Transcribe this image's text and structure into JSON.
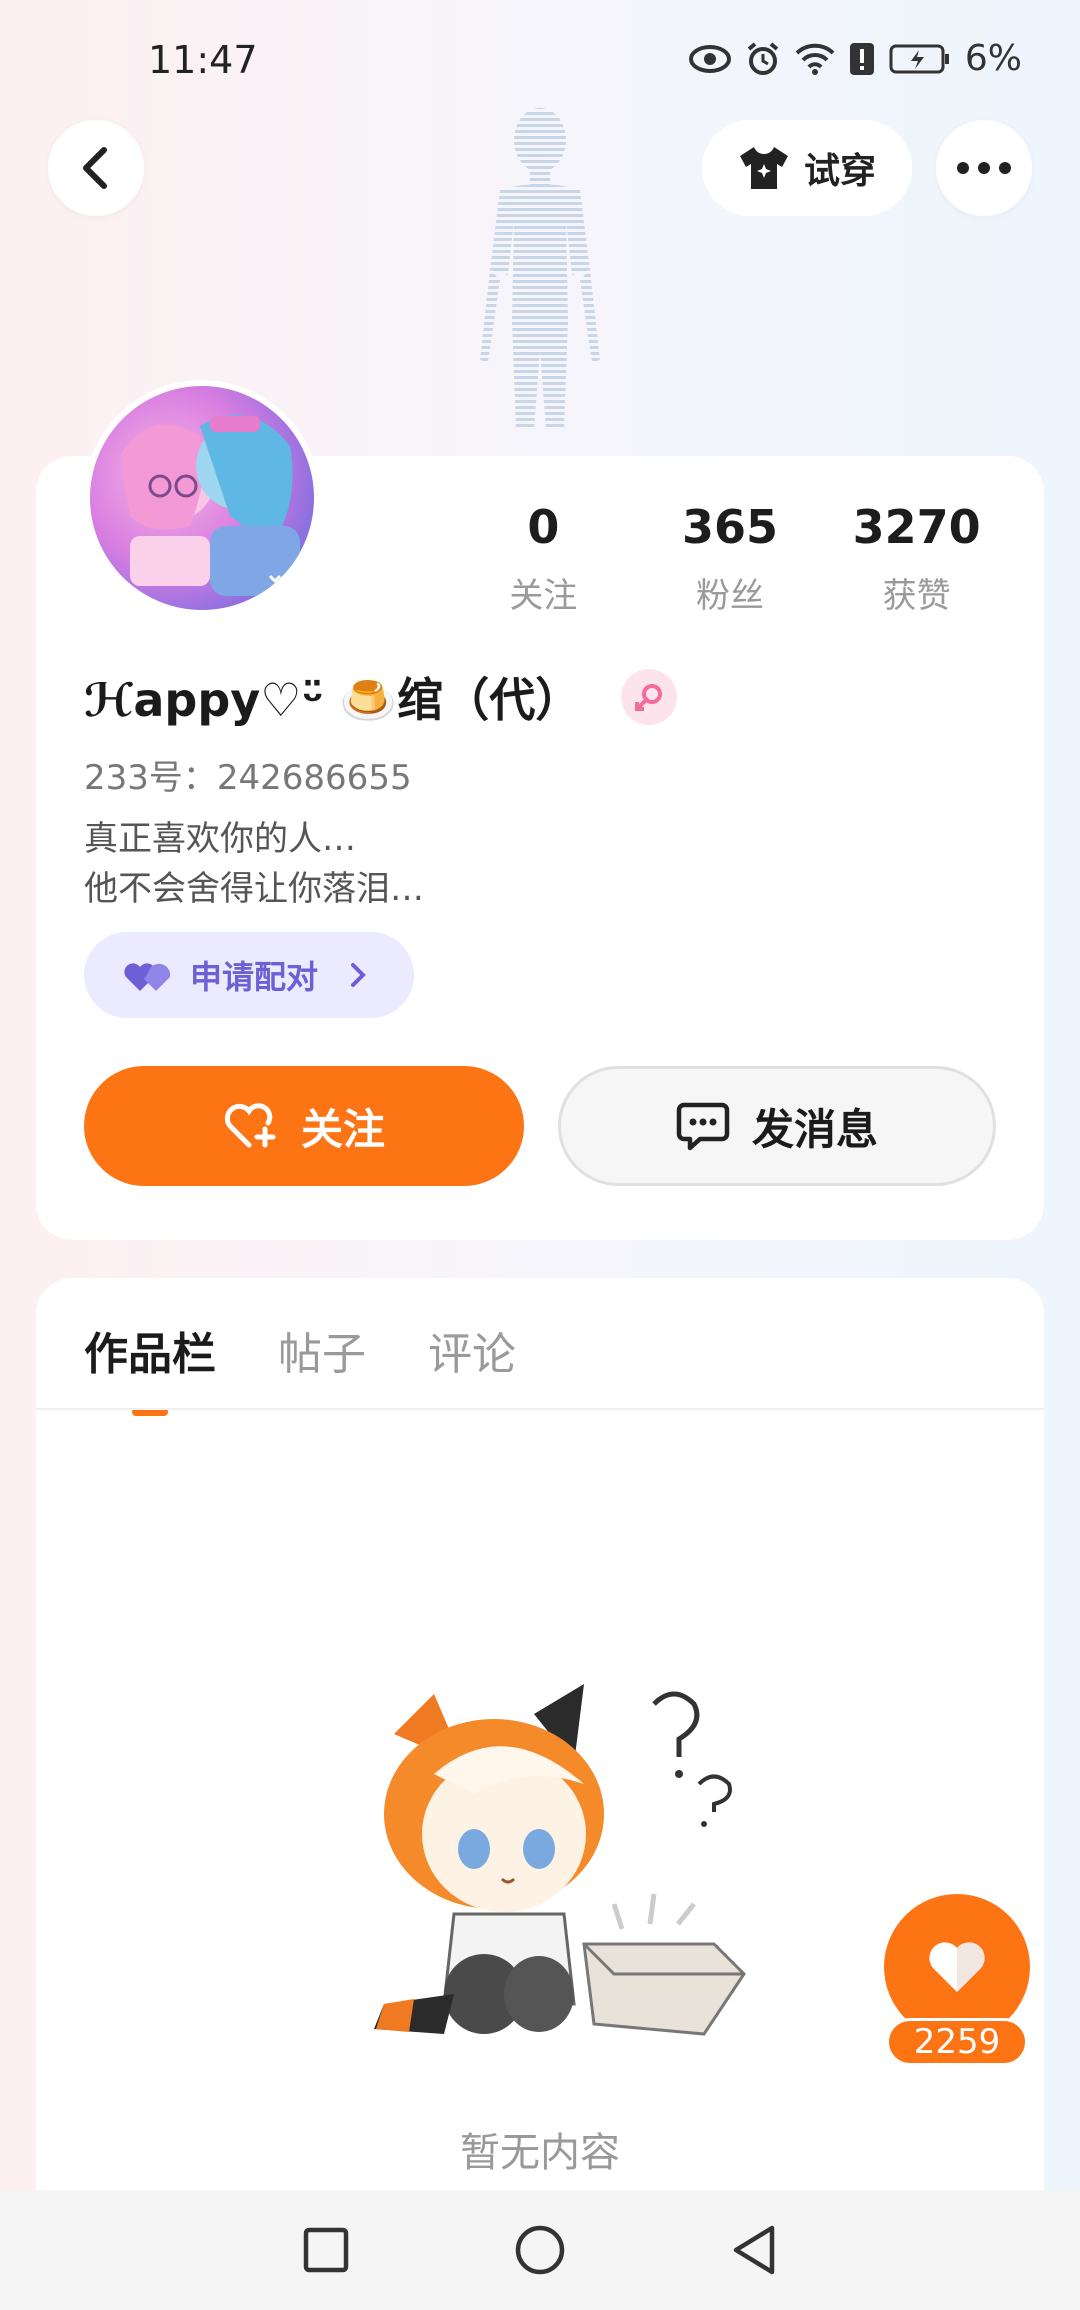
{
  "status_bar": {
    "time": "11:47",
    "battery": "6%",
    "icons": [
      "eye-icon",
      "alarm-icon",
      "wifi-icon",
      "alert-icon",
      "battery-icon"
    ]
  },
  "top_bar": {
    "try_on_label": "试穿"
  },
  "profile": {
    "stats": [
      {
        "value": "0",
        "label": "关注"
      },
      {
        "value": "365",
        "label": "粉丝"
      },
      {
        "value": "3270",
        "label": "获赞"
      }
    ],
    "nickname": "ℋappy♡ᵕ̈ 🍮绾（代）",
    "user_id": "233号：242686655",
    "bio_lines": [
      "真正喜欢你的人…",
      "他不会舍得让你落泪…"
    ],
    "pair_label": "申请配对",
    "follow_label": "关注",
    "message_label": "发消息"
  },
  "tabs": [
    {
      "label": "作品栏",
      "active": true
    },
    {
      "label": "帖子",
      "active": false
    },
    {
      "label": "评论",
      "active": false
    }
  ],
  "empty_state": {
    "text": "暂无内容"
  },
  "fab": {
    "count": "2259"
  },
  "colors": {
    "accent": "#fd7415",
    "pair_bg": "#eceaff",
    "pair_text": "#6d5fd6"
  }
}
